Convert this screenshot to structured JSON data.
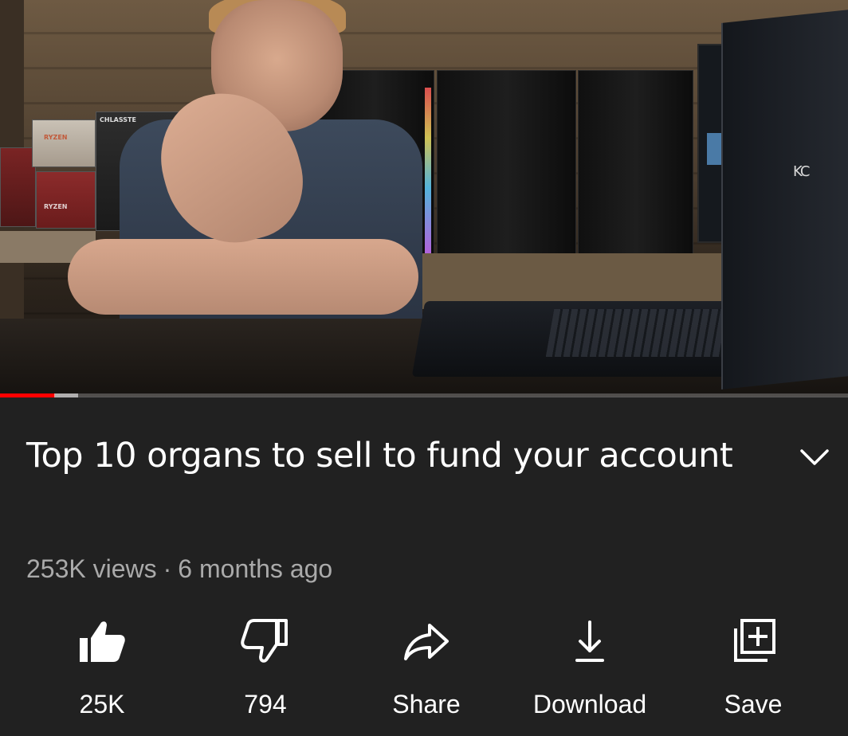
{
  "video": {
    "watermark": "KC",
    "box_brand_1": "CHLASSTE",
    "box_brand_2": "RYZEN",
    "box_brand_3": "RYZEN",
    "progress_played_fraction": 0.065,
    "accent_color": "#ff0000"
  },
  "info": {
    "title": "Top 10 organs to sell to fund your account",
    "views": "253K views",
    "separator": "·",
    "age": "6 months ago",
    "expand_icon": "chevron-down-icon"
  },
  "actions": {
    "like": {
      "label": "25K",
      "icon": "thumbs-up-icon"
    },
    "dislike": {
      "label": "794",
      "icon": "thumbs-down-icon"
    },
    "share": {
      "label": "Share",
      "icon": "share-arrow-icon"
    },
    "download": {
      "label": "Download",
      "icon": "download-icon"
    },
    "save": {
      "label": "Save",
      "icon": "add-to-playlist-icon"
    }
  },
  "colors": {
    "background": "#212121",
    "text_primary": "#ffffff",
    "text_secondary": "#aaaaaa"
  }
}
